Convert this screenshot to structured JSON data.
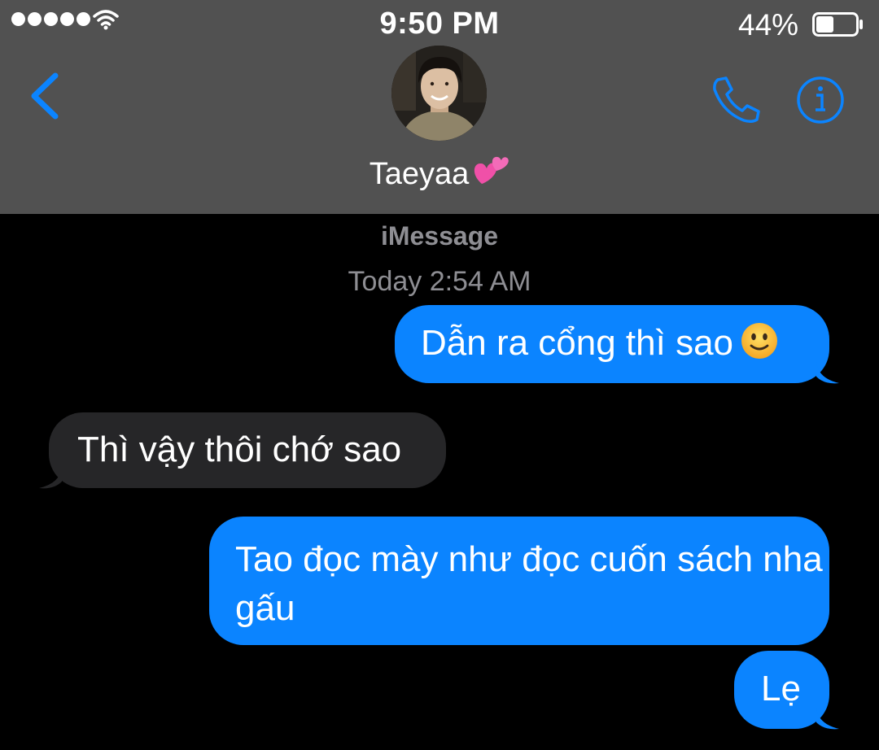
{
  "status_bar": {
    "time": "9:50 PM",
    "battery_percent": "44%",
    "battery_level": 0.44,
    "signal_bars": 5,
    "wifi_icon": "wifi-icon"
  },
  "nav": {
    "back_icon": "chevron-left-icon",
    "call_icon": "phone-icon",
    "info_icon": "info-icon",
    "accent_color": "#0b84ff"
  },
  "contact": {
    "name": "Taeyaa",
    "name_emoji": "two-hearts-emoji"
  },
  "thread": {
    "service": "iMessage",
    "timestamp": "Today 2:54 AM"
  },
  "messages": [
    {
      "direction": "sent",
      "text": "Dẫn ra cổng thì sao",
      "emoji": "slightly-smiling-face-emoji"
    },
    {
      "direction": "received",
      "text": "Thì vậy thôi chớ sao"
    },
    {
      "direction": "sent",
      "text": "Tao đọc mày như đọc cuốn sách nha gấu"
    },
    {
      "direction": "sent",
      "text": "Lẹ"
    }
  ],
  "colors": {
    "header_bg": "#515151",
    "sent_bubble": "#0b84ff",
    "received_bubble": "#262628",
    "background": "#000000",
    "secondary_text": "#8e8e93"
  }
}
